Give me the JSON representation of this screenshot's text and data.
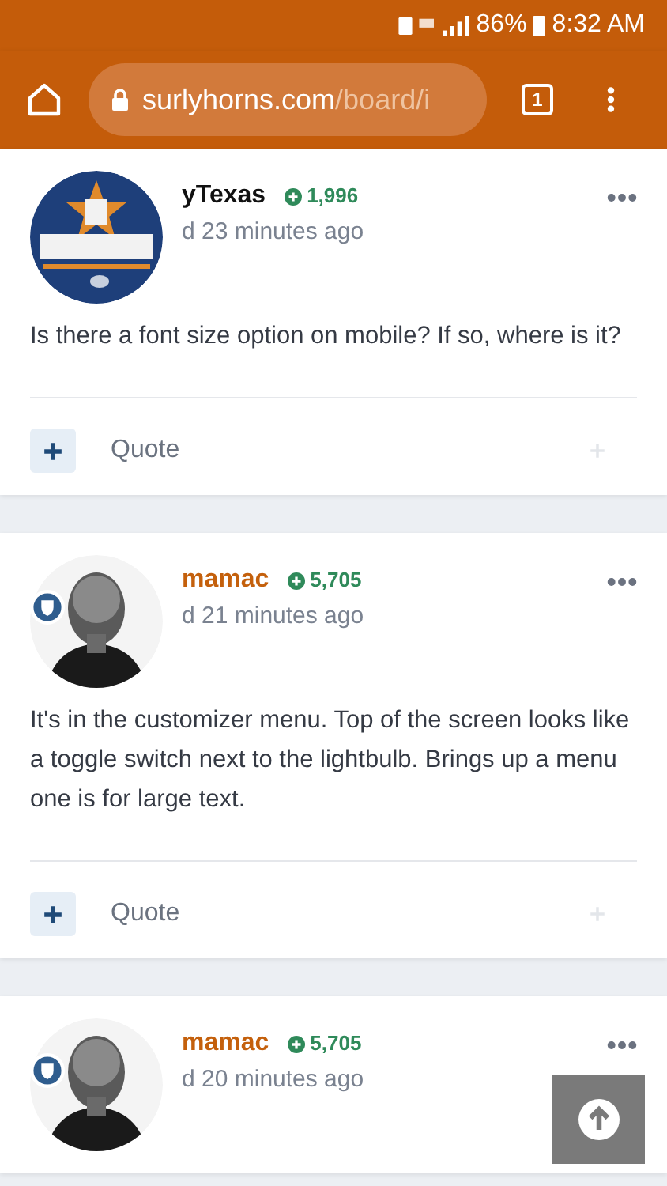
{
  "status_bar": {
    "battery": "86%",
    "time": "8:32 AM"
  },
  "toolbar": {
    "url_host": "surlyhorns.com",
    "url_path": "/board/i",
    "tab_count": "1"
  },
  "posts": [
    {
      "kind": "logo",
      "badge": false,
      "author": "yTexas",
      "color": "#111111",
      "reputation": "1,996",
      "time": "d 23 minutes ago",
      "body": "Is there a font size option on mobile?  If so, where is it?",
      "quote_label": "Quote"
    },
    {
      "kind": "person",
      "badge": true,
      "author": "mamac",
      "color": "#c4600c",
      "reputation": "5,705",
      "time": "d 21 minutes ago",
      "body": "It's in the customizer menu. Top of the screen looks like a toggle switch next to the lightbulb. Brings up a menu one is for large text.",
      "quote_label": "Quote"
    },
    {
      "kind": "person",
      "badge": true,
      "author": "mamac",
      "color": "#c4600c",
      "reputation": "5,705",
      "time": "d 20 minutes ago"
    }
  ]
}
